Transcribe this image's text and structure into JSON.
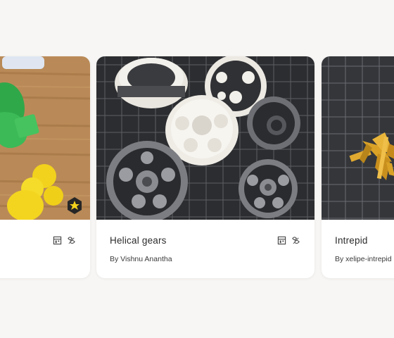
{
  "cards": [
    {
      "title": "",
      "author": "",
      "image_icon": "toy-figurines-photo",
      "badges": [
        "printer-icon",
        "filament-icon"
      ]
    },
    {
      "title": "Helical gears",
      "author": "By Vishnu Anantha",
      "image_icon": "3d-printed-gears-photo",
      "badges": [
        "printer-icon",
        "filament-icon"
      ]
    },
    {
      "title": "Intrepid",
      "author": "By xelipe-intrepid",
      "image_icon": "3d-printed-spaceship-photo",
      "badges": []
    }
  ],
  "colors": {
    "background": "#f7f6f4",
    "card": "#ffffff",
    "text": "#2b2b2b"
  }
}
